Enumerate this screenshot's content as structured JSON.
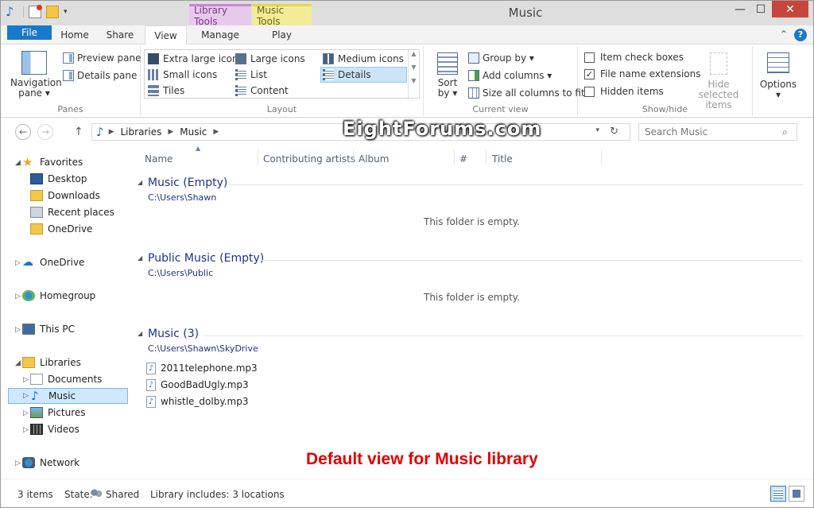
{
  "window": {
    "title": "Music"
  },
  "context_tabs": {
    "library_tools": "Library Tools",
    "music_tools": "Music Tools"
  },
  "tabs": {
    "file": "File",
    "home": "Home",
    "share": "Share",
    "view": "View",
    "manage": "Manage",
    "play": "Play"
  },
  "ribbon": {
    "panes": {
      "label": "Panes",
      "navigation_pane": "Navigation pane",
      "navigation_line1": "Navigation",
      "navigation_line2": "pane ▾",
      "preview_pane": "Preview pane",
      "details_pane": "Details pane"
    },
    "layout": {
      "label": "Layout",
      "extra_large_icons": "Extra large icons",
      "large_icons": "Large icons",
      "medium_icons": "Medium icons",
      "small_icons": "Small icons",
      "list": "List",
      "details": "Details",
      "tiles": "Tiles",
      "content": "Content"
    },
    "current_view": {
      "label": "Current view",
      "sort_line1": "Sort",
      "sort_line2": "by ▾",
      "group_by": "Group by ▾",
      "add_columns": "Add columns ▾",
      "size_all_columns": "Size all columns to fit"
    },
    "show_hide": {
      "label": "Show/hide",
      "item_check_boxes": "Item check boxes",
      "item_check_boxes_checked": false,
      "file_name_extensions": "File name extensions",
      "file_name_extensions_checked": true,
      "hidden_items": "Hidden items",
      "hidden_items_checked": false,
      "hide_selected_line1": "Hide selected",
      "hide_selected_line2": "items"
    },
    "options": {
      "line1": "Options",
      "line2": "▾"
    }
  },
  "address": {
    "crumbs": [
      "Libraries",
      "Music"
    ],
    "search_placeholder": "Search Music"
  },
  "watermark": "EightForums.com",
  "nav": {
    "favorites": "Favorites",
    "favorites_items": [
      "Desktop",
      "Downloads",
      "Recent places",
      "OneDrive"
    ],
    "onedrive": "OneDrive",
    "homegroup": "Homegroup",
    "this_pc": "This PC",
    "libraries": "Libraries",
    "libraries_items": [
      "Documents",
      "Music",
      "Pictures",
      "Videos"
    ],
    "network": "Network",
    "selected": "Music"
  },
  "columns": [
    "Name",
    "Contributing artists",
    "Album",
    "#",
    "Title"
  ],
  "groups": [
    {
      "title": "Music (Empty)",
      "path": "C:\\Users\\Shawn",
      "empty_text": "This folder is empty."
    },
    {
      "title": "Public Music (Empty)",
      "path": "C:\\Users\\Public",
      "empty_text": "This folder is empty."
    },
    {
      "title": "Music (3)",
      "path": "C:\\Users\\Shawn\\SkyDrive",
      "files": [
        "2011telephone.mp3",
        "GoodBadUgly.mp3",
        "whistle_dolby.mp3"
      ]
    }
  ],
  "caption": "Default view for Music library",
  "status": {
    "items": "3 items",
    "state_label": "State:",
    "state_value": "Shared",
    "library_includes": "Library includes: 3 locations"
  },
  "colors": {
    "file_tab": "#1979ca",
    "library_tools": "#e7c9ec",
    "music_tools": "#f2ec9a",
    "close": "#c7463b",
    "group_header": "#1e3287",
    "caption": "#e00000",
    "selection": "#cce4f7"
  }
}
